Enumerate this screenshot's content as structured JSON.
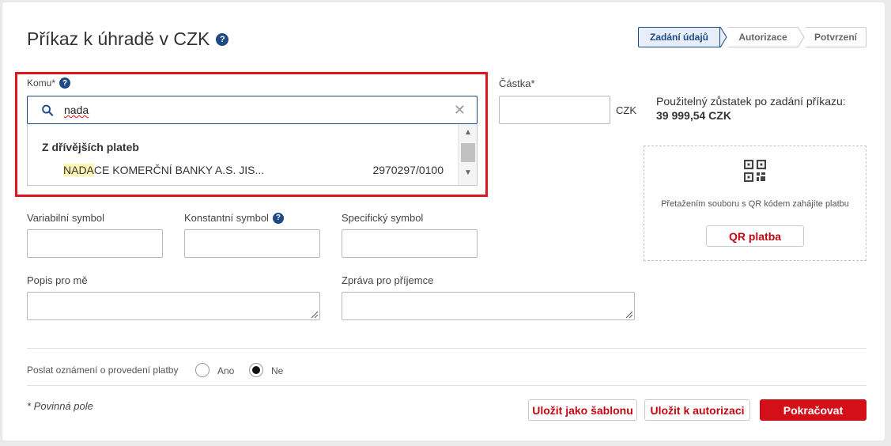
{
  "page": {
    "title": "Příkaz k úhradě v CZK",
    "help_icon": "question-circle-icon"
  },
  "steps": [
    {
      "label": "Zadání údajů",
      "active": true
    },
    {
      "label": "Autorizace",
      "active": false
    },
    {
      "label": "Potvrzení",
      "active": false
    }
  ],
  "recipient": {
    "label": "Komu*",
    "search_value": "nada",
    "search_icon": "search-icon",
    "clear_icon": "close-icon",
    "dropdown": {
      "group_label": "Z dřívějších plateb",
      "items": [
        {
          "name_highlight": "NADA",
          "name_rest": "CE KOMERČNÍ BANKY A.S. JIS...",
          "account": "2970297/0100"
        }
      ]
    }
  },
  "amount": {
    "label": "Částka*",
    "value": "",
    "currency": "CZK"
  },
  "balance": {
    "label": "Použitelný zůstatek po zadání příkazu:",
    "value": "39 999,54 CZK"
  },
  "qr": {
    "icon": "qr-code-icon",
    "text": "Přetažením souboru s QR kódem zahájíte platbu",
    "button_label": "QR platba"
  },
  "symbols": {
    "variable_label": "Variabilní symbol",
    "constant_label": "Konstantní symbol",
    "specific_label": "Specifický symbol"
  },
  "notes": {
    "own_label": "Popis pro mě",
    "recipient_label": "Zpráva pro příjemce"
  },
  "notification": {
    "label": "Poslat oznámení o provedení platby",
    "options": [
      {
        "label": "Ano",
        "selected": false
      },
      {
        "label": "Ne",
        "selected": true
      }
    ]
  },
  "footer": {
    "required_note": "* Povinná pole",
    "save_template_label": "Uložit jako šablonu",
    "save_auth_label": "Uložit k autorizaci",
    "continue_label": "Pokračovat"
  },
  "colors": {
    "accent": "#1d4a86",
    "brand_red": "#d3101a",
    "highlight_box": "#e0151d"
  }
}
